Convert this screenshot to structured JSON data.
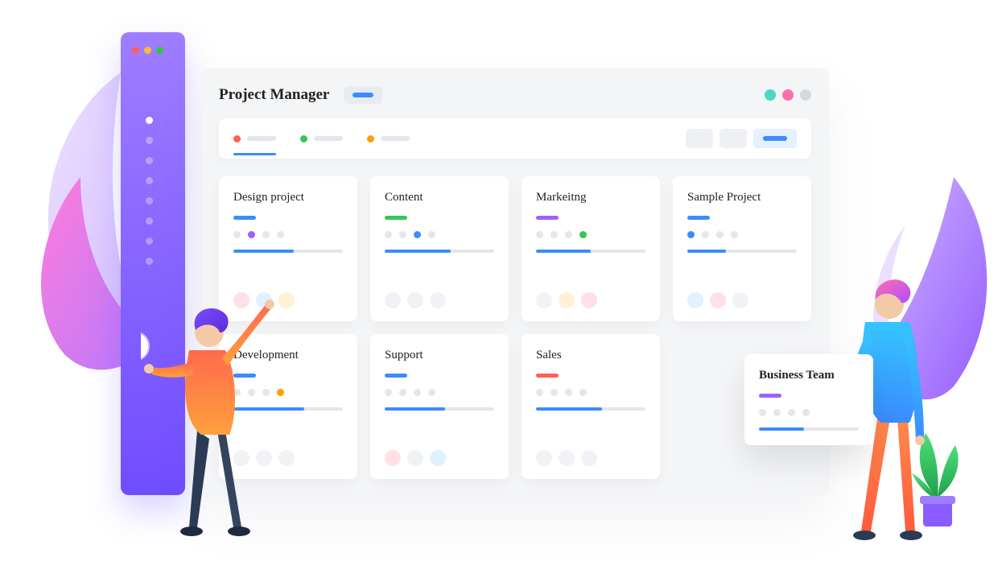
{
  "header": {
    "title": "Project Manager"
  },
  "filter_tabs": [
    {
      "color": "red",
      "active": true
    },
    {
      "color": "green",
      "active": false
    },
    {
      "color": "orange",
      "active": false
    }
  ],
  "projects": [
    {
      "title": "Design project",
      "accent": "#3b8cff",
      "highlight_index": 1,
      "highlight_color": "#9f5fff",
      "progress_color": "#3b8cff",
      "progress_pct": 55,
      "chip_colors": [
        "#ffe0e6",
        "#e0f2ff",
        "#fff0d6"
      ]
    },
    {
      "title": "Content",
      "accent": "#34c759",
      "highlight_index": 2,
      "highlight_color": "#3b8cff",
      "progress_color": "#3b8cff",
      "progress_pct": 60,
      "chip_colors": [
        "#f0f2f5",
        "#f0f2f5",
        "#f0f2f5"
      ]
    },
    {
      "title": "Markeitng",
      "accent": "#9f5fff",
      "highlight_index": 3,
      "highlight_color": "#34c759",
      "progress_color": "#3b8cff",
      "progress_pct": 50,
      "chip_colors": [
        "#f0f2f5",
        "#fff0d6",
        "#ffe0e6"
      ]
    },
    {
      "title": "Sample Project",
      "accent": "#3b8cff",
      "highlight_index": 0,
      "highlight_color": "#3b8cff",
      "progress_color": "#3b8cff",
      "progress_pct": 35,
      "chip_colors": [
        "#e0f2ff",
        "#ffe0e6",
        "#f0f2f5"
      ]
    },
    {
      "title": "Development",
      "accent": "#3b8cff",
      "highlight_index": 3,
      "highlight_color": "#ff9f0a",
      "progress_color": "#3b8cff",
      "progress_pct": 65,
      "chip_colors": [
        "#f0f2f5",
        "#f0f2f5",
        "#f0f2f5"
      ]
    },
    {
      "title": "Support",
      "accent": "#3b8cff",
      "highlight_index": null,
      "highlight_color": null,
      "progress_color": "#3b8cff",
      "progress_pct": 55,
      "chip_colors": [
        "#ffe0e6",
        "#f0f2f5",
        "#e0f2ff"
      ]
    },
    {
      "title": "Sales",
      "accent": "#ff5f57",
      "highlight_index": null,
      "highlight_color": null,
      "progress_color": "#3b8cff",
      "progress_pct": 60,
      "chip_colors": [
        "#f0f2f5",
        "#f0f2f5",
        "#f0f2f5"
      ]
    }
  ],
  "floating_card": {
    "title": "Business Team",
    "accent": "#9f5fff",
    "progress_pct": 45,
    "progress_color": "#3b8cff"
  },
  "sidebar_active_index": 0,
  "sidebar_item_count": 8
}
